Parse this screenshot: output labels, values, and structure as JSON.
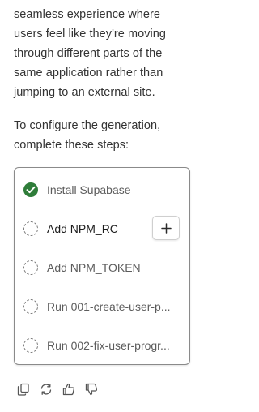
{
  "message": {
    "paragraph1_lines": [
      "seamless experience where",
      "users feel like they're moving",
      "through different parts of the",
      "same application rather than",
      "jumping to an external site."
    ],
    "paragraph2_lines": [
      "To configure the generation,",
      "complete these steps:"
    ]
  },
  "steps": [
    {
      "label": "Install Supabase",
      "status": "done",
      "icon": "check-circle-icon"
    },
    {
      "label": "Add NPM_RC",
      "status": "active",
      "icon": "dashed-circle-icon",
      "action": "plus-icon"
    },
    {
      "label": "Add NPM_TOKEN",
      "status": "pending",
      "icon": "dashed-circle-icon"
    },
    {
      "label": "Run 001-create-user-p...",
      "status": "pending",
      "icon": "dashed-circle-icon"
    },
    {
      "label": "Run 002-fix-user-progr...",
      "status": "pending",
      "icon": "dashed-circle-icon"
    }
  ],
  "actions": [
    {
      "icon": "copy-icon"
    },
    {
      "icon": "refresh-icon"
    },
    {
      "icon": "thumbs-up-icon"
    },
    {
      "icon": "thumbs-down-icon"
    }
  ],
  "colors": {
    "success": "#2f7d3a",
    "text": "#333333",
    "muted": "#5c5c5c",
    "border": "#8a8a8a"
  }
}
